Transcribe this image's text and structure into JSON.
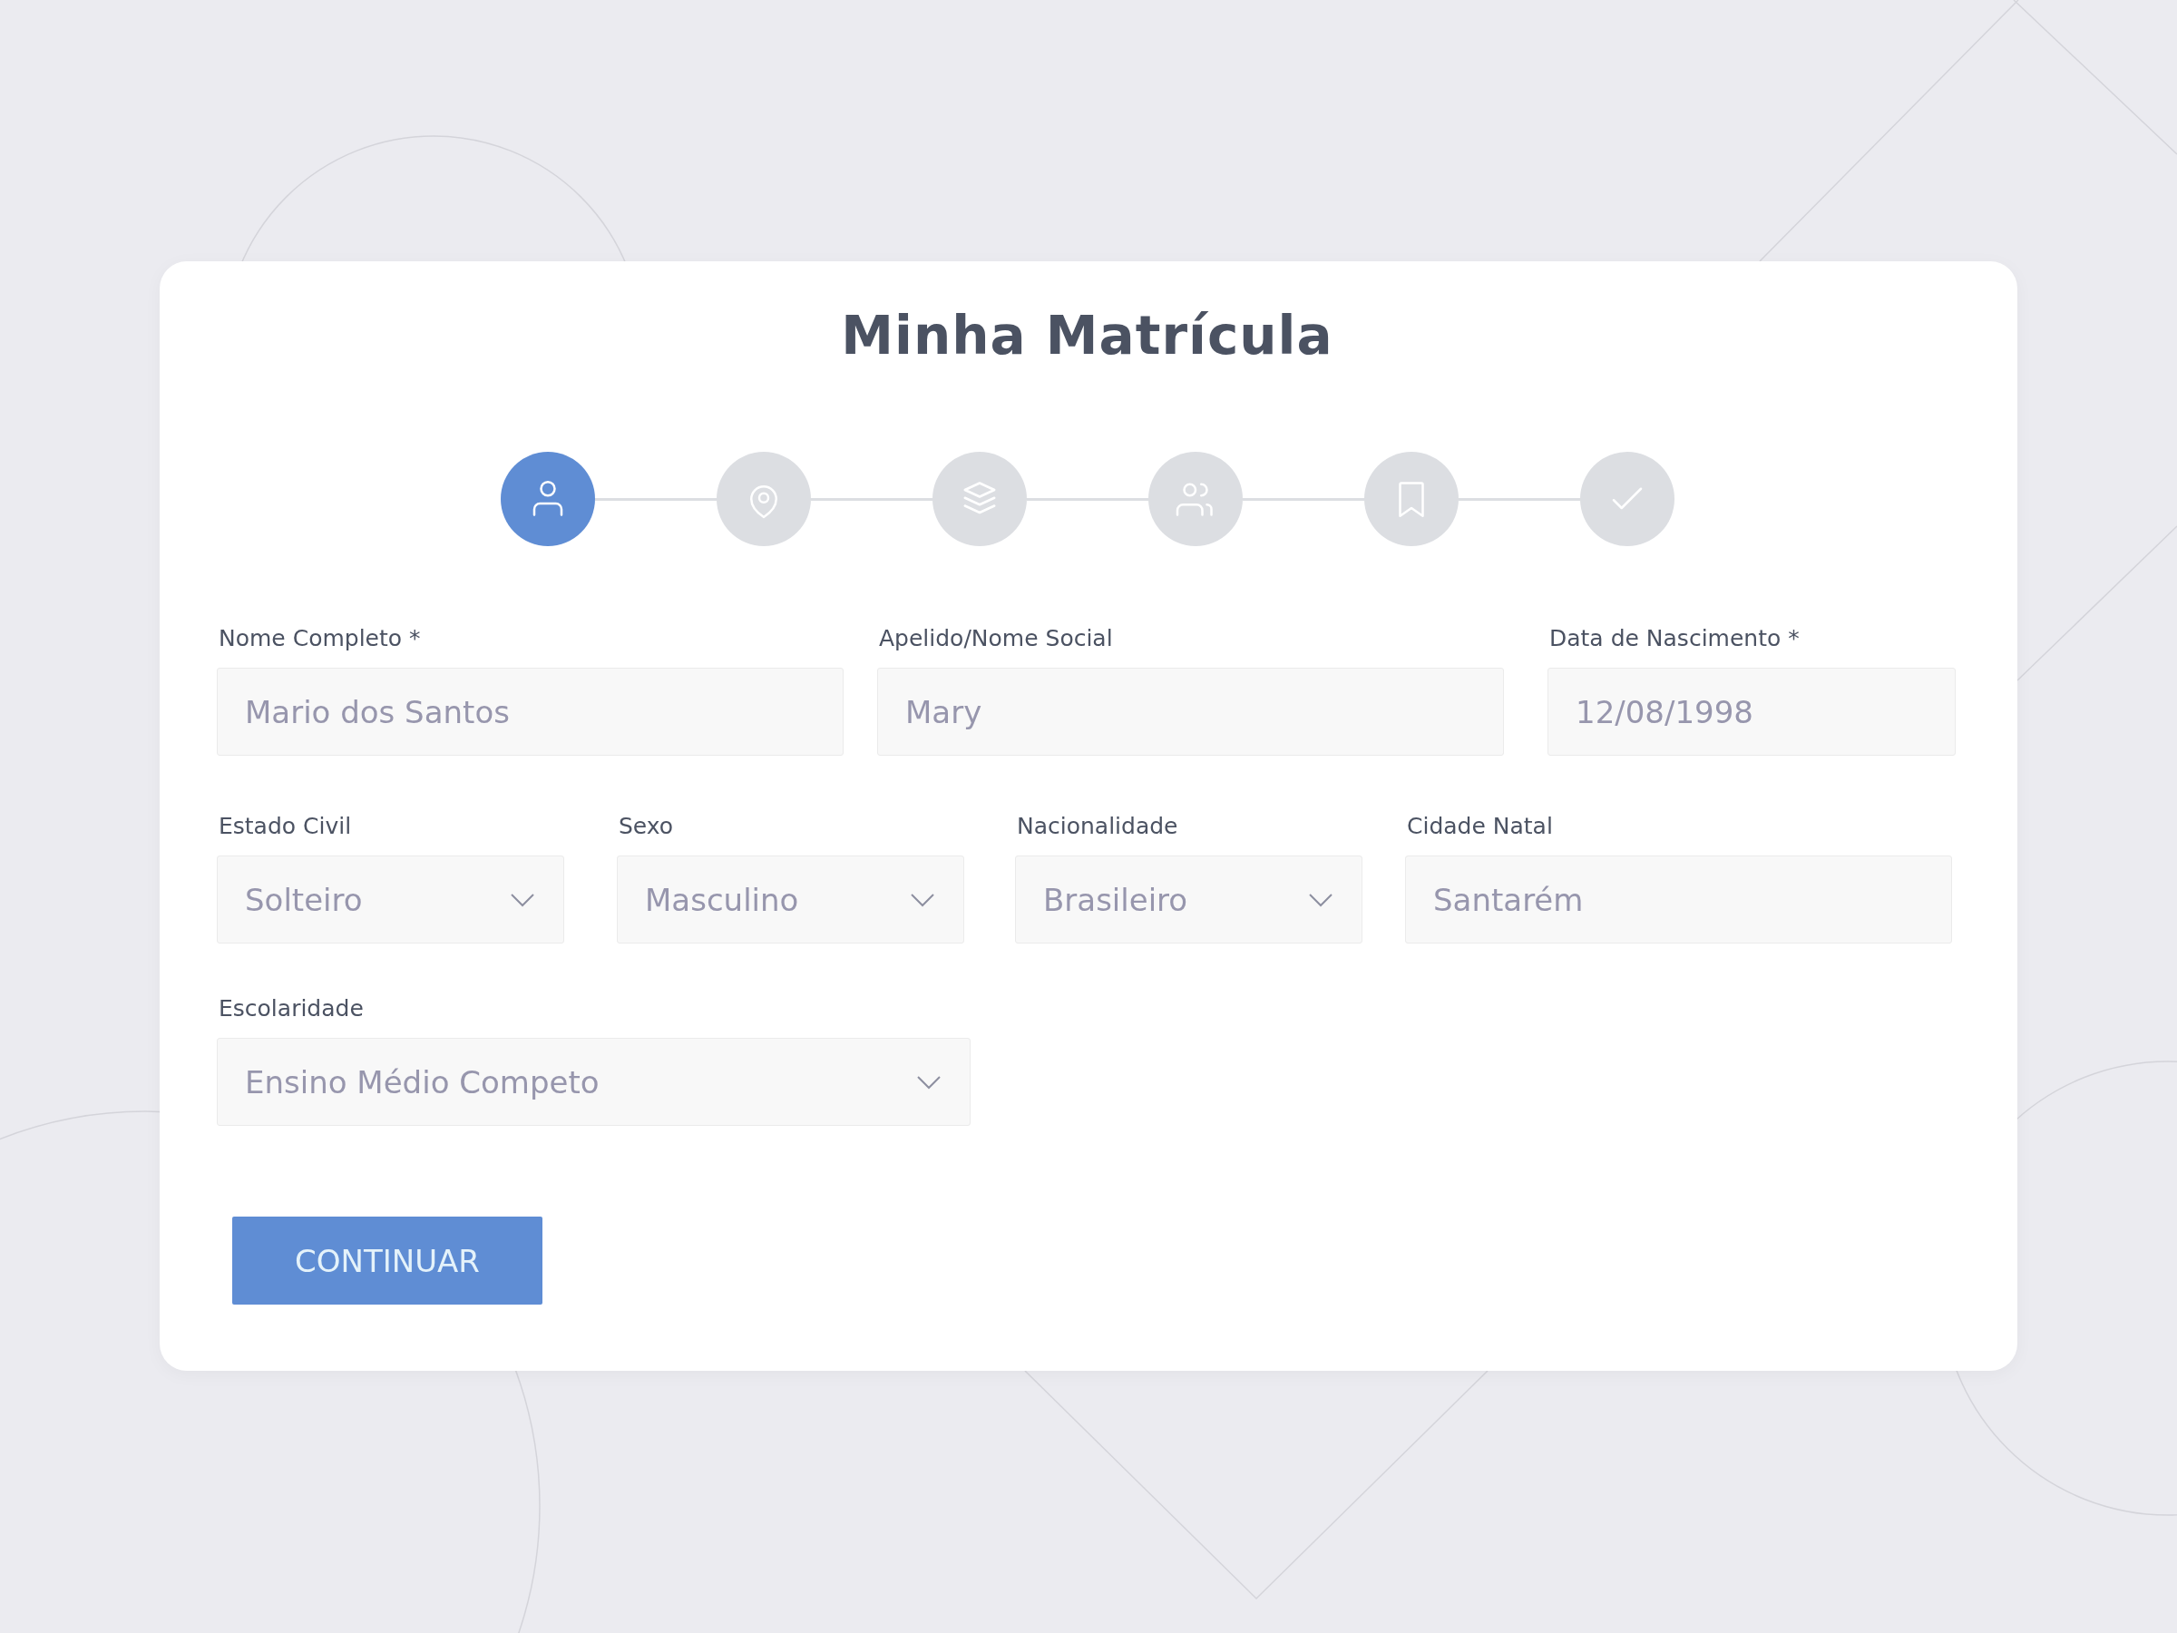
{
  "title": "Minha Matrícula",
  "steps": [
    {
      "kind": "person",
      "selected": true
    },
    {
      "kind": "pin",
      "selected": false
    },
    {
      "kind": "layers",
      "selected": false
    },
    {
      "kind": "people",
      "selected": false
    },
    {
      "kind": "bookmark",
      "selected": false
    },
    {
      "kind": "check",
      "selected": false
    }
  ],
  "rows": [
    [
      {
        "label": "Nome Completo *",
        "kind": "text",
        "value": "Mario dos Santos"
      },
      {
        "label": "Apelido/Nome Social",
        "kind": "text",
        "value": "Mary"
      },
      {
        "label": "Data de Nascimento *",
        "kind": "text",
        "value": "12/08/1998"
      }
    ],
    [
      {
        "label": "Estado Civil",
        "kind": "select",
        "value": "Solteiro"
      },
      {
        "label": "Sexo",
        "kind": "select",
        "value": "Masculino"
      },
      {
        "label": "Nacionalidade",
        "kind": "select",
        "value": "Brasileiro"
      },
      {
        "label": "Cidade Natal",
        "kind": "text",
        "value": "Santarém"
      }
    ],
    [
      {
        "label": "Escolaridade",
        "kind": "select",
        "value": "Ensino Médio Competo"
      }
    ]
  ],
  "button": "CONTINUAR"
}
